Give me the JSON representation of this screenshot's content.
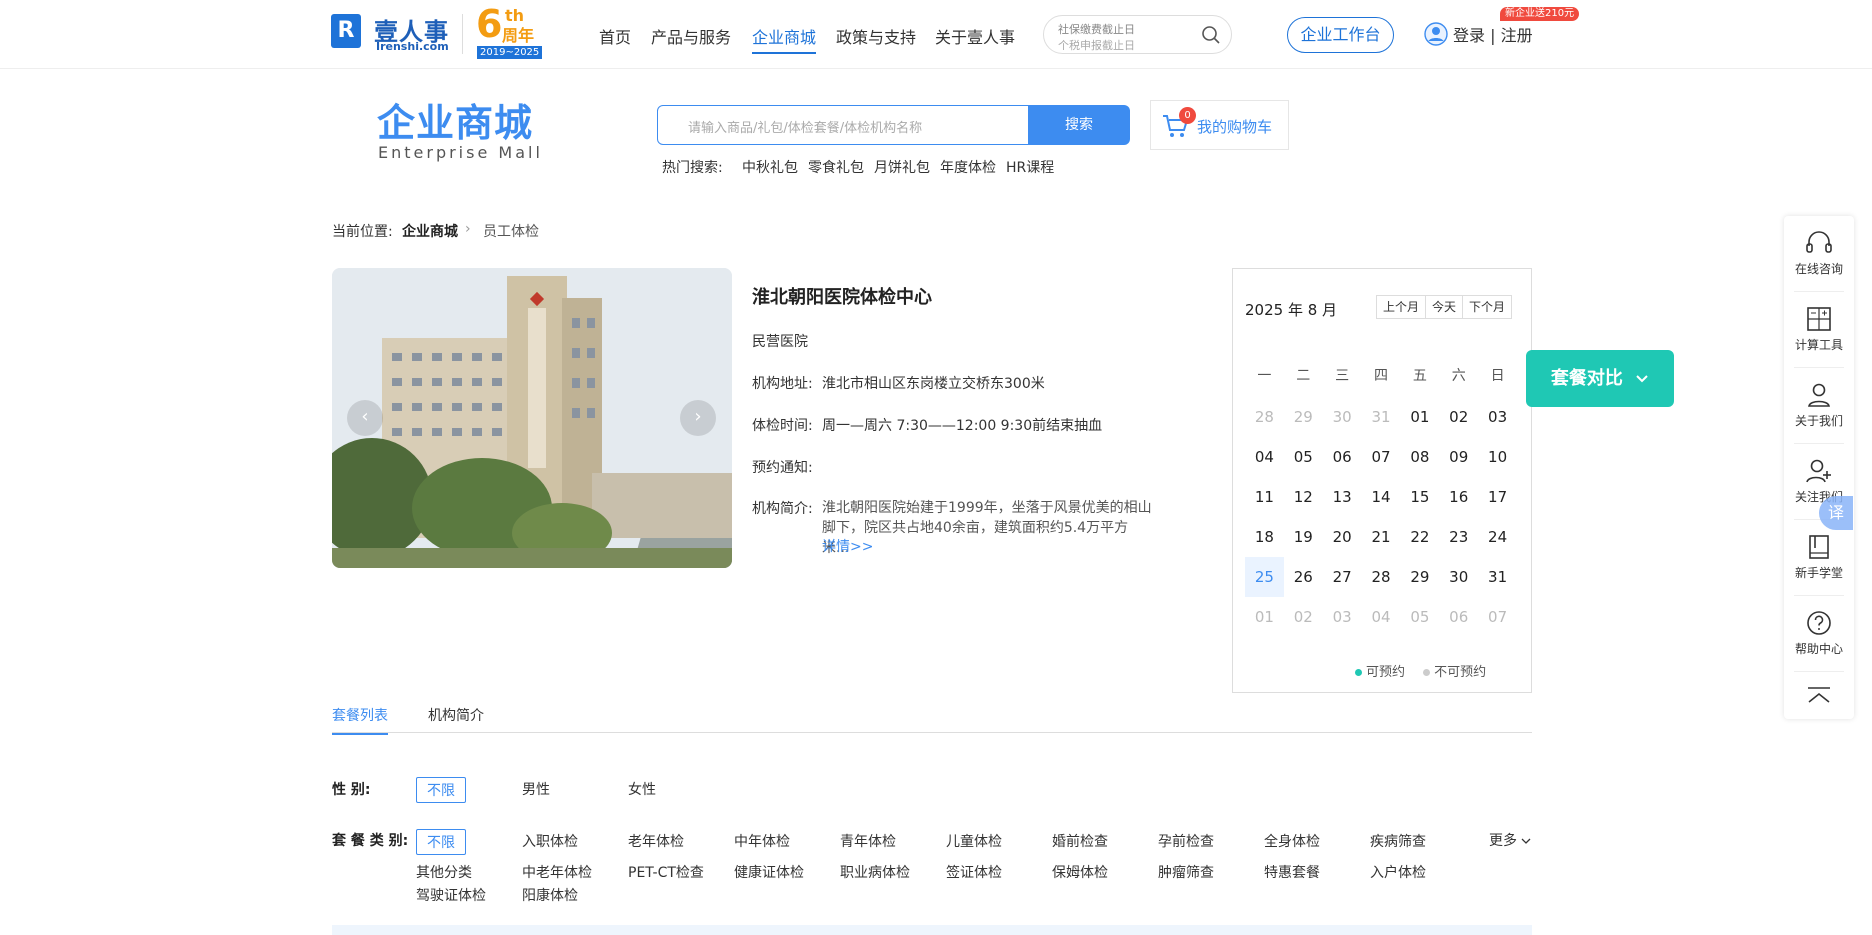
{
  "header": {
    "logo_text": "壹人事",
    "logo_sub": "Irenshi.com",
    "anniv_num": "6",
    "anniv_th": "th",
    "anniv_label": "周年",
    "anniv_years": "2019~2025",
    "nav": [
      "首页",
      "产品与服务",
      "企业商城",
      "政策与支持",
      "关于壹人事"
    ],
    "active_nav": "企业商城",
    "search_line1": "社保缴费截止日",
    "search_line2": "个税申报截止日",
    "workbench": "企业工作台",
    "login": "登录 | 注册",
    "promo": "新企业送210元"
  },
  "mall": {
    "title": "企业商城",
    "title_en": "Enterprise  Mall",
    "search_placeholder": "请输入商品/礼包/体检套餐/体检机构名称",
    "search_btn": "搜索",
    "cart_label": "我的购物车",
    "cart_count": "0",
    "hot_label": "热门搜索:",
    "hot": [
      "中秋礼包",
      "零食礼包",
      "月饼礼包",
      "年度体检",
      "HR课程"
    ]
  },
  "breadcrumb": {
    "label": "当前位置:",
    "items": [
      "企业商城",
      "员工体检"
    ]
  },
  "hospital": {
    "name": "淮北朝阳医院体检中心",
    "type": "民营医院",
    "addr_label": "机构地址:",
    "addr": "淮北市相山区东岗楼立交桥东300米",
    "time_label": "体检时间:",
    "time": "周一—周六 7:30——12:00 9:30前结束抽血",
    "notice_label": "预约通知:",
    "intro_label": "机构简介:",
    "intro": "淮北朝阳医院始建于1999年，坐落于风景优美的相山脚下，院区共占地40余亩，建筑面积约5.4万平方米...",
    "more": "详情>>"
  },
  "calendar": {
    "title": "2025 年 8 月",
    "prev": "上个月",
    "today": "今天",
    "next": "下个月",
    "weekdays": [
      "一",
      "二",
      "三",
      "四",
      "五",
      "六",
      "日"
    ],
    "weeks": [
      [
        "28",
        "29",
        "30",
        "31",
        "01",
        "02",
        "03"
      ],
      [
        "04",
        "05",
        "06",
        "07",
        "08",
        "09",
        "10"
      ],
      [
        "11",
        "12",
        "13",
        "14",
        "15",
        "16",
        "17"
      ],
      [
        "18",
        "19",
        "20",
        "21",
        "22",
        "23",
        "24"
      ],
      [
        "25",
        "26",
        "27",
        "28",
        "29",
        "30",
        "31"
      ],
      [
        "01",
        "02",
        "03",
        "04",
        "05",
        "06",
        "07"
      ]
    ],
    "legend_yes": "可预约",
    "legend_no": "不可预约",
    "color_yes": "#1fc8b4",
    "color_no": "#cccccc"
  },
  "compare_btn": "套餐对比",
  "rbar": [
    "在线咨询",
    "计算工具",
    "关于我们",
    "关注我们",
    "新手学堂",
    "帮助中心"
  ],
  "translate": "译",
  "tabs": [
    "套餐列表",
    "机构简介"
  ],
  "filters": {
    "gender_label": "性      别:",
    "gender_opts": [
      "不限",
      "男性",
      "女性"
    ],
    "type_label": "套 餐 类 别:",
    "type_row1": [
      "不限",
      "入职体检",
      "老年体检",
      "中年体检",
      "青年体检",
      "儿童体检",
      "婚前检查",
      "孕前检查",
      "全身体检",
      "疾病筛查"
    ],
    "type_row2": [
      "其他分类",
      "中老年体检",
      "PET-CT检查",
      "健康证体检",
      "职业病体检",
      "签证体检",
      "保姆体检",
      "肿瘤筛查",
      "特惠套餐",
      "入户体检"
    ],
    "type_row3": [
      "驾驶证体检",
      "阳康体检"
    ],
    "more": "更多"
  }
}
